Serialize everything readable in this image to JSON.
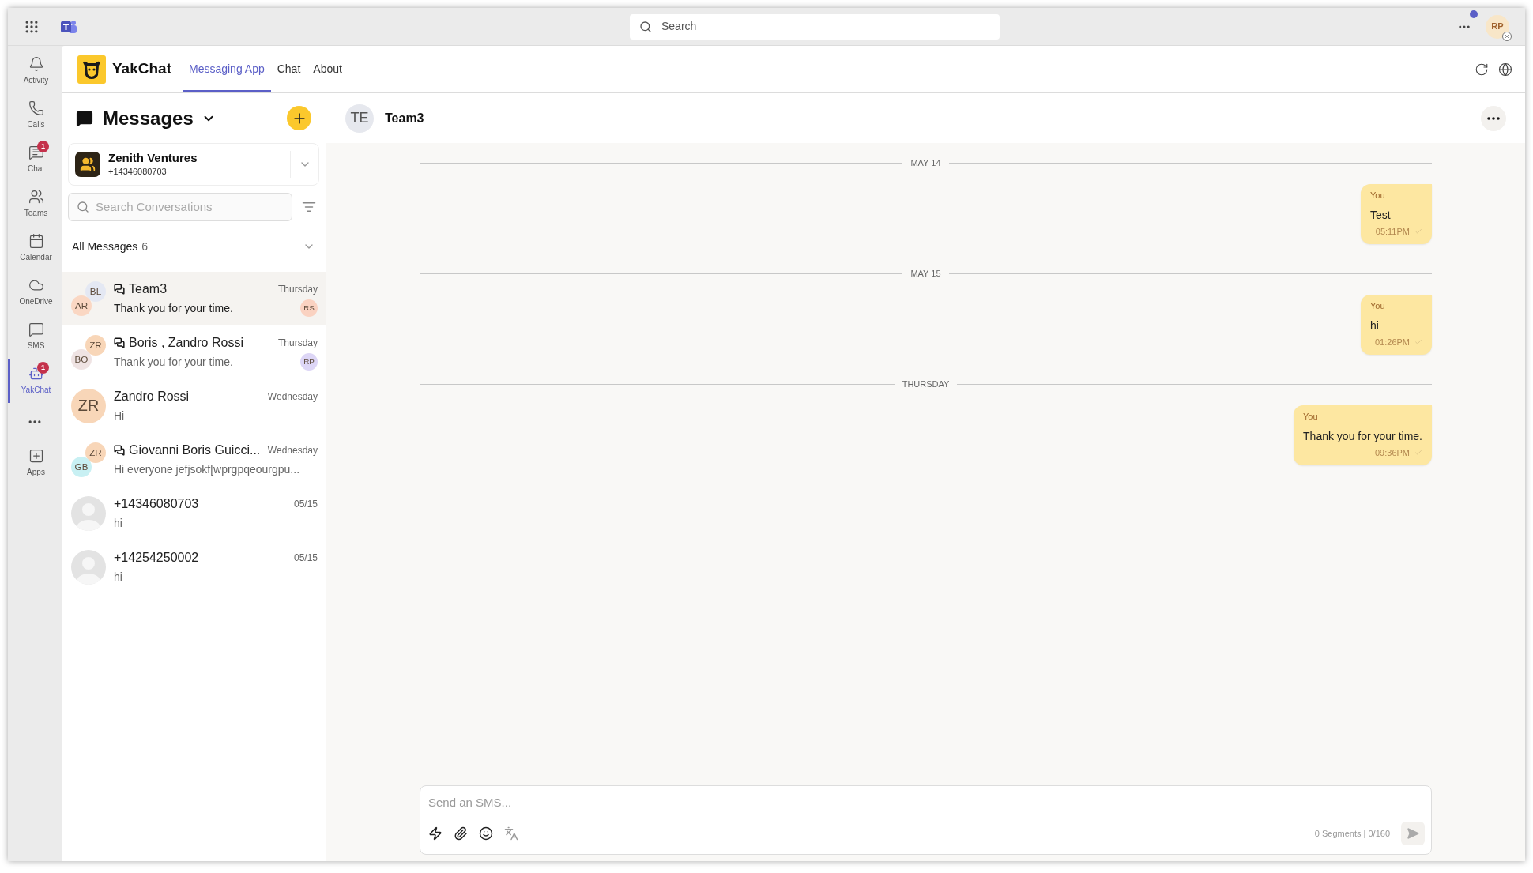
{
  "top_bar": {
    "search": {
      "placeholder": "Search"
    },
    "user": {
      "initials": "RP",
      "notification": true
    }
  },
  "rail": [
    {
      "label": "Activity",
      "selected": false
    },
    {
      "label": "Calls",
      "selected": false
    },
    {
      "label": "Chat",
      "selected": false,
      "badge": "1"
    },
    {
      "label": "Teams",
      "selected": false
    },
    {
      "label": "Calendar",
      "selected": false
    },
    {
      "label": "OneDrive",
      "selected": false
    },
    {
      "label": "SMS",
      "selected": false
    },
    {
      "label": "YakChat",
      "selected": true,
      "badge": "1"
    },
    {
      "label": "Apps",
      "selected": false
    }
  ],
  "app_header": {
    "name": "YakChat",
    "tabs": [
      {
        "label": "Messaging App",
        "selected": true
      },
      {
        "label": "Chat",
        "selected": false
      },
      {
        "label": "About",
        "selected": false
      }
    ]
  },
  "messages_panel": {
    "title": "Messages",
    "account": {
      "name": "Zenith Ventures",
      "number": "+14346080703"
    },
    "search": {
      "placeholder": "Search Conversations"
    },
    "filter": {
      "label": "All Messages",
      "count": "6"
    },
    "conversations": [
      {
        "kind": "group",
        "avatars": [
          {
            "initials": "BL",
            "color": "#e4e8f3"
          },
          {
            "initials": "AR",
            "color": "#fad7c3"
          }
        ],
        "name": "Team3",
        "preview": "Thank you for your time.",
        "date": "Thursday",
        "read_by": {
          "initials": "RS",
          "color": "#fad2c1"
        },
        "selected": true
      },
      {
        "kind": "group",
        "avatars": [
          {
            "initials": "ZR",
            "color": "#f8d6b8"
          },
          {
            "initials": "BO",
            "color": "#efe3e3"
          }
        ],
        "name": "Boris , Zandro Rossi",
        "preview": "Thank you for your time.",
        "date": "Thursday",
        "read_by": {
          "initials": "RP",
          "color": "#ddd6f6"
        },
        "selected": false
      },
      {
        "kind": "single",
        "avatars": [
          {
            "initials": "ZR",
            "color": "#f8d6b8"
          }
        ],
        "name": "Zandro Rossi",
        "preview": "Hi",
        "date": "Wednesday",
        "selected": false
      },
      {
        "kind": "group",
        "avatars": [
          {
            "initials": "ZR",
            "color": "#f8d6b8"
          },
          {
            "initials": "GB",
            "color": "#c8f0f3"
          }
        ],
        "name": "Giovanni Boris Guicci...",
        "preview": "Hi everyone jefjsokf[wprgpqeourgpu...",
        "date": "Wednesday",
        "selected": false
      },
      {
        "kind": "unknown",
        "name": "+14346080703",
        "preview": "hi",
        "date": "05/15",
        "selected": false
      },
      {
        "kind": "unknown",
        "name": "+14254250002",
        "preview": "hi",
        "date": "05/15",
        "selected": false
      }
    ]
  },
  "chat": {
    "initials": "TE",
    "title": "Team3",
    "timeline": [
      {
        "kind": "divider",
        "label": "MAY 14"
      },
      {
        "kind": "message",
        "sender": "You",
        "text": "Test",
        "time": "05:11PM",
        "delivered": true
      },
      {
        "kind": "divider",
        "label": "MAY 15"
      },
      {
        "kind": "message",
        "sender": "You",
        "text": "hi",
        "time": "01:26PM",
        "delivered": true
      },
      {
        "kind": "divider",
        "label": "THURSDAY"
      },
      {
        "kind": "message",
        "sender": "You",
        "text": "Thank you for your time.",
        "time": "09:36PM",
        "delivered": true
      }
    ],
    "composer": {
      "placeholder": "Send an SMS...",
      "counter": "0 Segments | 0/160"
    }
  }
}
